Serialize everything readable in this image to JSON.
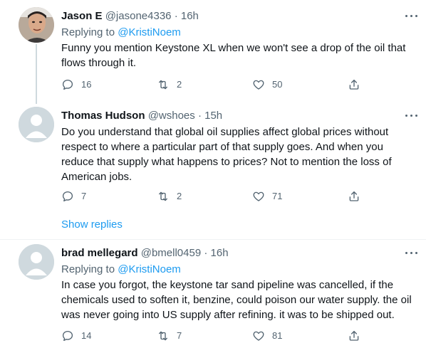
{
  "tweets": [
    {
      "name": "Jason E",
      "handle": "@jasone4336",
      "separator": "·",
      "time": "16h",
      "reply_prefix": "Replying to",
      "reply_mention": "@KristiNoem",
      "text": "Funny you mention Keystone XL when we won't see a drop of the oil that flows through it.",
      "replies": "16",
      "retweets": "2",
      "likes": "50"
    },
    {
      "name": "Thomas Hudson",
      "handle": "@wshoes",
      "separator": "·",
      "time": "15h",
      "text": "Do you understand that global oil supplies affect global prices without respect to where a particular part of that supply goes.  And when you reduce that supply what happens to prices? Not to mention the loss of American jobs.",
      "replies": "7",
      "retweets": "2",
      "likes": "71",
      "show_replies": "Show replies"
    },
    {
      "name": "brad mellegard",
      "handle": "@bmell0459",
      "separator": "·",
      "time": "16h",
      "reply_prefix": "Replying to",
      "reply_mention": "@KristiNoem",
      "text": "In case you forgot, the keystone tar sand pipeline was cancelled, if the chemicals used to soften it, benzine, could poison our water supply. the oil was never going into US supply after refining. it was to be shipped out.",
      "replies": "14",
      "retweets": "7",
      "likes": "81"
    }
  ],
  "icons": {
    "reply": "reply-icon",
    "retweet": "retweet-icon",
    "like": "heart-icon",
    "share": "share-icon",
    "more": "more-icon"
  },
  "colors": {
    "link": "#1d9bf0",
    "secondary_text": "#536471",
    "divider": "#eff3f4",
    "avatar_placeholder": "#cfd9de"
  }
}
